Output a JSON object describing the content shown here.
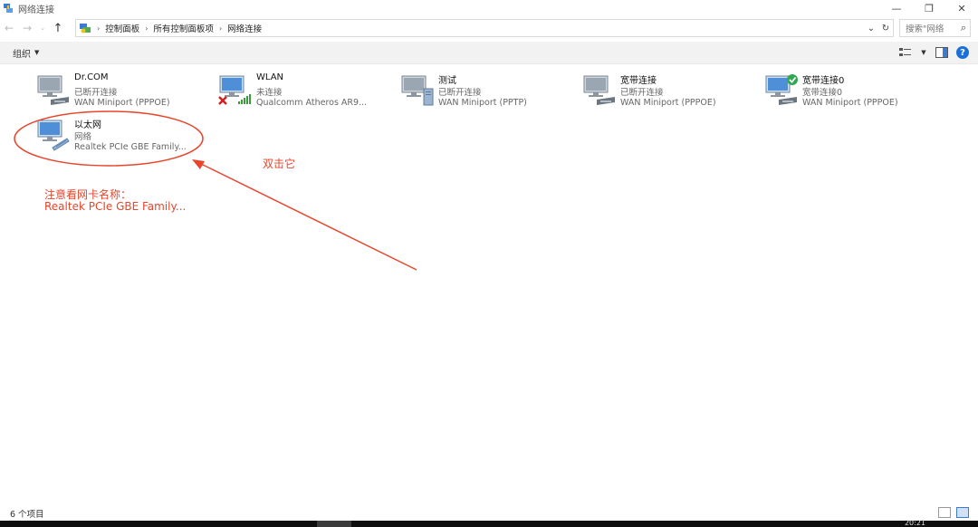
{
  "window": {
    "title": "网络连接",
    "minimize": "—",
    "restore": "❐",
    "close": "✕"
  },
  "nav": {
    "back": "←",
    "forward": "→",
    "recent": "⌄",
    "up": "↑"
  },
  "address": {
    "breadcrumb": [
      "控制面板",
      "所有控制面板项",
      "网络连接"
    ],
    "separator": "›",
    "dropdown": "⌄",
    "refresh": "↻"
  },
  "search": {
    "placeholder": "搜索\"网络",
    "icon": "⌕"
  },
  "toolbar": {
    "organize_label": "组织",
    "organize_caret": "▼",
    "view_caret": "▼",
    "help_label": "?"
  },
  "items": [
    {
      "name": "Dr.COM",
      "status": "已断开连接",
      "device": "WAN Miniport (PPPOE)",
      "icon": "monitor-modem-icon"
    },
    {
      "name": "WLAN",
      "status": "未连接",
      "device": "Qualcomm Atheros AR9...",
      "icon": "wifi-disconnected-icon"
    },
    {
      "name": "测试",
      "status": "已断开连接",
      "device": "WAN Miniport (PPTP)",
      "icon": "monitor-server-icon"
    },
    {
      "name": "宽带连接",
      "status": "已断开连接",
      "device": "WAN Miniport (PPPOE)",
      "icon": "monitor-modem-icon"
    },
    {
      "name": "宽带连接0",
      "status": "宽带连接0",
      "device": "WAN Miniport (PPPOE)",
      "icon": "monitor-modem-connected-icon"
    },
    {
      "name": "以太网",
      "status": "网络",
      "device": "Realtek PCIe GBE Family...",
      "icon": "ethernet-icon"
    }
  ],
  "annotations": {
    "double_click": "双击它",
    "note_line1": "注意看网卡名称：",
    "note_line2": "Realtek PCIe GBE Family...",
    "color": "#e8452c"
  },
  "statusbar": {
    "count": "6 个项目"
  },
  "taskbar": {
    "clock": "20:21"
  }
}
